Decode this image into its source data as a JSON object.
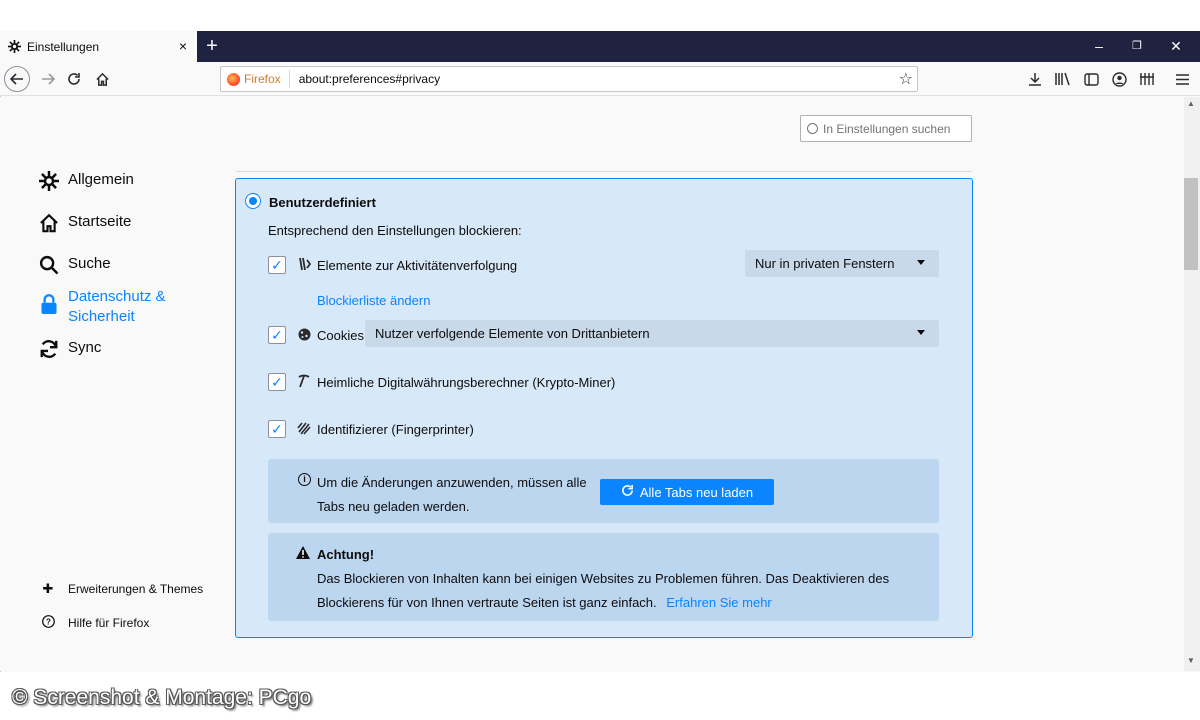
{
  "tab": {
    "title": "Einstellungen",
    "close": "×",
    "new_tab": "+"
  },
  "window_controls": {
    "minimize": "–",
    "maximize": "❐",
    "close": "✕"
  },
  "urlbar": {
    "identity": "Firefox",
    "url": "about:preferences#privacy"
  },
  "search": {
    "placeholder": "In Einstellungen suchen"
  },
  "sidebar": {
    "items": [
      {
        "label": "Allgemein",
        "icon": "gear-icon"
      },
      {
        "label": "Startseite",
        "icon": "home-icon"
      },
      {
        "label": "Suche",
        "icon": "search-icon"
      },
      {
        "label_line1": "Datenschutz &",
        "label_line2": "Sicherheit",
        "icon": "lock-icon",
        "active": true
      },
      {
        "label": "Sync",
        "icon": "sync-icon"
      }
    ],
    "footer": [
      {
        "label": "Erweiterungen & Themes",
        "icon": "puzzle-icon"
      },
      {
        "label": "Hilfe für Firefox",
        "icon": "help-icon"
      }
    ]
  },
  "custom": {
    "radio_label": "Benutzerdefiniert",
    "description": "Entsprechend den Einstellungen blockieren:",
    "tracking": {
      "label": "Elemente zur Aktivitätenverfolgung",
      "dropdown": "Nur in privaten Fenstern",
      "checked": true
    },
    "blocklist_link": "Blockierliste ändern",
    "cookies": {
      "label": "Cookies",
      "dropdown": "Nutzer verfolgende Elemente von Drittanbietern",
      "checked": true
    },
    "cryptominers": {
      "label": "Heimliche Digitalwährungsberechner (Krypto-Miner)",
      "checked": true
    },
    "fingerprinters": {
      "label": "Identifizierer (Fingerprinter)",
      "checked": true
    }
  },
  "reload_notice": {
    "text": "Um die Änderungen anzuwenden, müssen alle Tabs neu geladen werden.",
    "button": "Alle Tabs neu laden"
  },
  "warning": {
    "title": "Achtung!",
    "line1": "Das Blockieren von Inhalten kann bei einigen Websites zu Problemen führen. Das Deaktivieren des",
    "line2": "Blockierens für von Ihnen vertraute Seiten ist ganz einfach.",
    "link": "Erfahren Sie mehr"
  },
  "watermark": "© Screenshot & Montage: PCgo",
  "colors": {
    "accent": "#0a84ff",
    "tabstrip": "#202340",
    "panel": "#d7e8f8",
    "notice": "#bcd6f0"
  }
}
